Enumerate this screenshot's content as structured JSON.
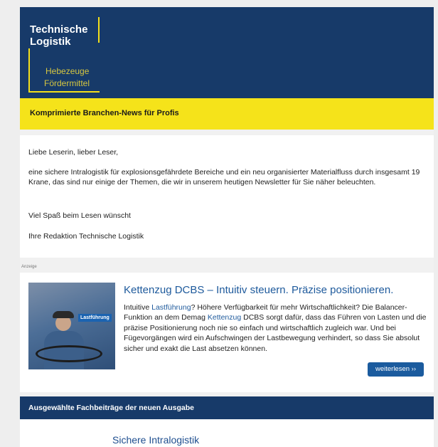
{
  "logo": {
    "line1": "Technische",
    "line2": "Logistik",
    "line3": "Hebezeuge",
    "line4": "Fördermittel"
  },
  "tagline": "Komprimierte Branchen-News für Profis",
  "intro": {
    "greeting": "Liebe Leserin, lieber Leser,",
    "body": "eine sichere Intralogistik für explosionsgefährdete Bereiche und ein neu organisierter Materialfluss durch insgesamt 19 Krane, das sind nur einige der Themen, die wir in unserem heutigen Newsletter für Sie näher beleuchten.",
    "closing": "Viel Spaß beim Lesen wünscht",
    "signature": "Ihre Redaktion Technische Logistik"
  },
  "ad": {
    "label": "Anzeige",
    "title": "Kettenzug DCBS – Intuitiv steuern. Präzise positionieren.",
    "image_tag": "Lastführung",
    "text_1": "Intuitive ",
    "link_1": "Lastführung",
    "text_2": "? Höhere Verfügbarkeit für mehr Wirtschaftlichkeit? Die Balancer-Funktion an dem Demag ",
    "link_2": "Kettenzug",
    "text_3": " DCBS sorgt dafür, dass das Führen von Lasten und die präzise Positionierung noch nie so einfach und wirtschaftlich zugleich war. Und bei Fügevorgängen wird ein Aufschwingen der Lastbewegung verhindert, so dass Sie absolut sicher und exakt die Last absetzen können.",
    "button": "weiterlesen ››"
  },
  "section": {
    "title": "Ausgewählte Fachbeiträge der neuen Ausgabe"
  },
  "article": {
    "title": "Sichere Intralogistik"
  },
  "colors": {
    "navy": "#173a69",
    "yellow": "#f5e31a",
    "link_blue": "#1e5a9c"
  }
}
